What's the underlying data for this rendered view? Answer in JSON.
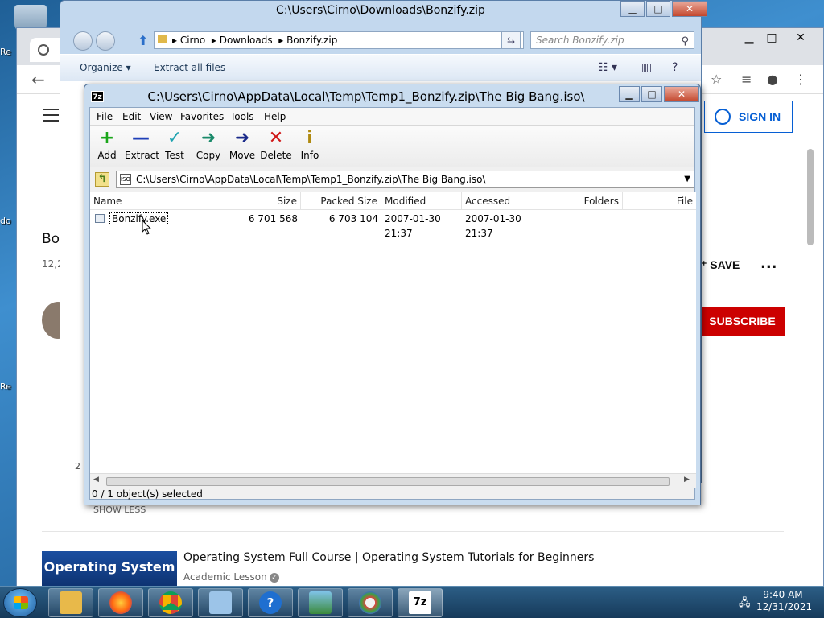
{
  "desktop": {
    "icon_labels": [
      "Re",
      "do",
      "Re"
    ]
  },
  "youtube": {
    "sign_in": "SIGN IN",
    "video_title_partial": "Bo",
    "views_partial": "12,2",
    "save": "SAVE",
    "more": "...",
    "subscribe": "SUBSCRIBE",
    "show_less": "SHOW LESS",
    "recommended_title": "Operating System Full Course | Operating System Tutorials for Beginners",
    "recommended_channel": "Academic Lesson",
    "thumb_text": "Operating System",
    "side_partial": "2"
  },
  "explorer": {
    "title": "C:\\Users\\Cirno\\Downloads\\Bonzify.zip",
    "breadcrumb": [
      "Cirno",
      "Downloads",
      "Bonzify.zip"
    ],
    "search_placeholder": "Search Bonzify.zip",
    "commands": {
      "organize": "Organize ▾",
      "extract_all": "Extract all files"
    }
  },
  "zip": {
    "title": "C:\\Users\\Cirno\\AppData\\Local\\Temp\\Temp1_Bonzify.zip\\The Big Bang.iso\\",
    "app_icon": "7z",
    "menu": [
      "File",
      "Edit",
      "View",
      "Favorites",
      "Tools",
      "Help"
    ],
    "toolbar": [
      {
        "label": "Add",
        "icon": "+",
        "color": "#1aa61a"
      },
      {
        "label": "Extract",
        "icon": "—",
        "color": "#1f3fb8"
      },
      {
        "label": "Test",
        "icon": "✓",
        "color": "#1fa3b0"
      },
      {
        "label": "Copy",
        "icon": "➜",
        "color": "#1a8a6a"
      },
      {
        "label": "Move",
        "icon": "➜",
        "color": "#1a2a8a"
      },
      {
        "label": "Delete",
        "icon": "✕",
        "color": "#d01818"
      },
      {
        "label": "Info",
        "icon": "i",
        "color": "#b08a10"
      }
    ],
    "path": "C:\\Users\\Cirno\\AppData\\Local\\Temp\\Temp1_Bonzify.zip\\The Big Bang.iso\\",
    "columns": [
      "Name",
      "Size",
      "Packed Size",
      "Modified",
      "Accessed",
      "Folders",
      "File"
    ],
    "rows": [
      {
        "name": "Bonzify.exe",
        "size": "6 701 568",
        "packed": "6 703 104",
        "modified": "2007-01-30 21:37",
        "accessed": "2007-01-30 21:37"
      }
    ],
    "status": "0 / 1 object(s) selected"
  },
  "taskbar": {
    "help_glyph": "?",
    "zip_glyph": "7z",
    "time": "9:40 AM",
    "date": "12/31/2021"
  },
  "win_controls": {
    "minimize": "▁",
    "maximize": "□",
    "close": "✕"
  }
}
